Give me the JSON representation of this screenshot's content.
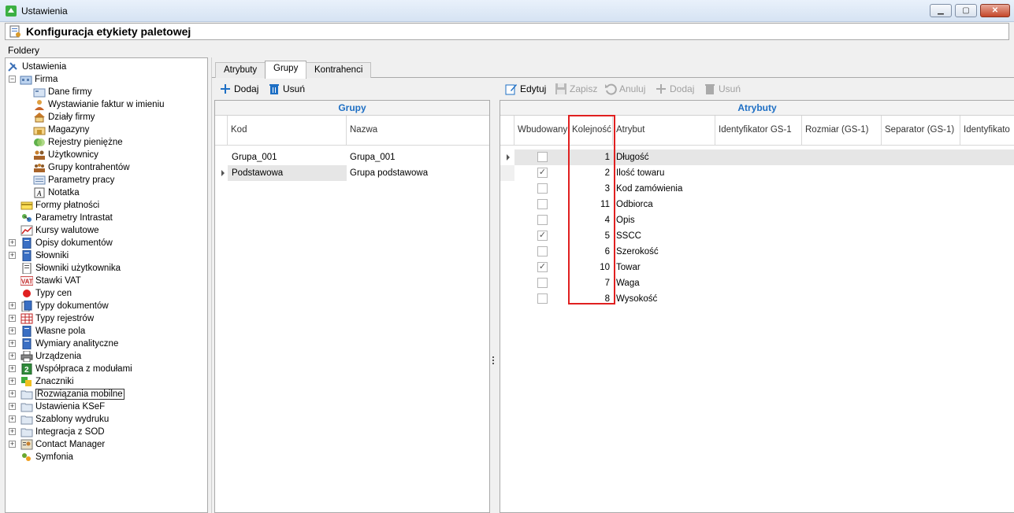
{
  "window": {
    "title": "Ustawienia"
  },
  "header": {
    "title": "Konfiguracja etykiety paletowej"
  },
  "sidebar": {
    "label": "Foldery",
    "items": [
      "Ustawienia",
      "Firma",
      "Dane firmy",
      "Wystawianie faktur w imieniu",
      "Działy firmy",
      "Magazyny",
      "Rejestry pieniężne",
      "Użytkownicy",
      "Grupy kontrahentów",
      "Parametry pracy",
      "Notatka",
      "Formy płatności",
      "Parametry Intrastat",
      "Kursy walutowe",
      "Opisy dokumentów",
      "Słowniki",
      "Słowniki użytkownika",
      "Stawki VAT",
      "Typy cen",
      "Typy dokumentów",
      "Typy rejestrów",
      "Własne pola",
      "Wymiary analityczne",
      "Urządzenia",
      "Współpraca z modułami",
      "Znaczniki",
      "Rozwiązania mobilne",
      "Ustawienia KSeF",
      "Szablony wydruku",
      "Integracja z SOD",
      "Contact Manager",
      "Symfonia"
    ]
  },
  "tabs": [
    "Atrybuty",
    "Grupy",
    "Kontrahenci"
  ],
  "groups_toolbar": {
    "add": "Dodaj",
    "delete": "Usuń"
  },
  "attr_toolbar": {
    "edit": "Edytuj",
    "save": "Zapisz",
    "cancel": "Anuluj",
    "add": "Dodaj",
    "delete": "Usuń"
  },
  "groups": {
    "title": "Grupy",
    "columns": [
      "Kod",
      "Nazwa"
    ],
    "rows": [
      {
        "kod": "Grupa_001",
        "nazwa": "Grupa_001"
      },
      {
        "kod": "Podstawowa",
        "nazwa": "Grupa podstawowa"
      }
    ]
  },
  "attributes": {
    "title": "Atrybuty",
    "columns": [
      "Wbudowany",
      "Kolejność",
      "Atrybut",
      "Identyfikator GS-1",
      "Rozmiar (GS-1)",
      "Separator (GS-1)",
      "Identyfikato"
    ],
    "rows": [
      {
        "wbudowany": false,
        "kolejnosc": "1",
        "atrybut": "Długość"
      },
      {
        "wbudowany": true,
        "kolejnosc": "2",
        "atrybut": "Ilość towaru"
      },
      {
        "wbudowany": false,
        "kolejnosc": "3",
        "atrybut": "Kod zamówienia"
      },
      {
        "wbudowany": false,
        "kolejnosc": "11",
        "atrybut": "Odbiorca"
      },
      {
        "wbudowany": false,
        "kolejnosc": "4",
        "atrybut": "Opis"
      },
      {
        "wbudowany": true,
        "kolejnosc": "5",
        "atrybut": "SSCC"
      },
      {
        "wbudowany": false,
        "kolejnosc": "6",
        "atrybut": "Szerokość"
      },
      {
        "wbudowany": true,
        "kolejnosc": "10",
        "atrybut": "Towar"
      },
      {
        "wbudowany": false,
        "kolejnosc": "7",
        "atrybut": "Waga"
      },
      {
        "wbudowany": false,
        "kolejnosc": "8",
        "atrybut": "Wysokość"
      }
    ]
  },
  "colors": {
    "accent": "#1e6fc4",
    "highlight": "#e02020"
  }
}
